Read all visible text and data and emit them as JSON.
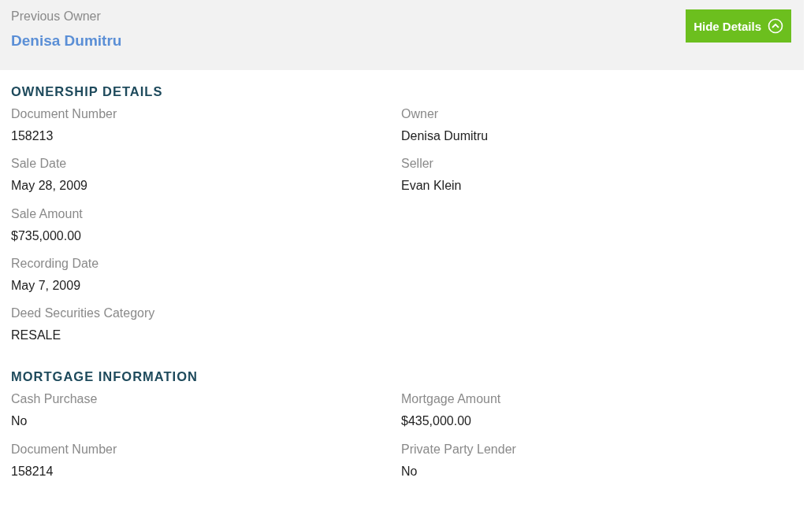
{
  "header": {
    "label": "Previous Owner",
    "name": "Denisa Dumitru",
    "toggle": {
      "label": "Hide Details",
      "expanded": true
    }
  },
  "sections": [
    {
      "title": "OWNERSHIP DETAILS",
      "columns": [
        [
          {
            "label": "Document Number",
            "value": "158213"
          },
          {
            "label": "Sale Date",
            "value": "May 28, 2009"
          },
          {
            "label": "Sale Amount",
            "value": "$735,000.00"
          },
          {
            "label": "Recording Date",
            "value": "May 7, 2009"
          },
          {
            "label": "Deed Securities Category",
            "value": "RESALE"
          }
        ],
        [
          {
            "label": "Owner",
            "value": "Denisa Dumitru"
          },
          {
            "label": "Seller",
            "value": "Evan Klein"
          }
        ]
      ]
    },
    {
      "title": "MORTGAGE INFORMATION",
      "columns": [
        [
          {
            "label": "Cash Purchase",
            "value": "No"
          },
          {
            "label": "Document Number",
            "value": "158214"
          }
        ],
        [
          {
            "label": "Mortgage Amount",
            "value": "$435,000.00"
          },
          {
            "label": "Private Party Lender",
            "value": "No"
          }
        ]
      ]
    }
  ]
}
